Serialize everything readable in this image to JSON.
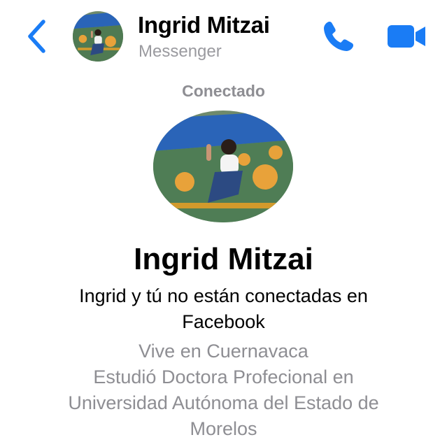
{
  "header": {
    "name": "Ingrid Mitzai",
    "subtitle": "Messenger",
    "icons": {
      "back": "chevron-left-icon",
      "call": "phone-icon",
      "video": "video-camera-icon"
    },
    "accent_color": "#1a7cf5"
  },
  "profile": {
    "status": "Conectado",
    "name": "Ingrid Mitzai",
    "connection_note": "Ingrid y tú no están conectadas en Facebook",
    "info_lines": [
      "Vive en Cuernavaca",
      "Estudió Doctora Profecional en",
      "Universidad Autónoma del Estado de",
      "Morelos"
    ]
  }
}
